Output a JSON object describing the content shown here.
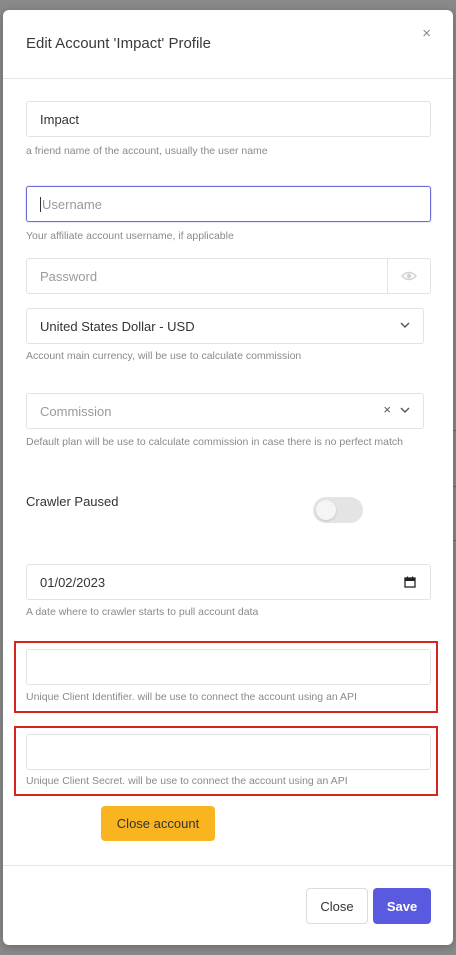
{
  "modal": {
    "title": "Edit Account 'Impact' Profile",
    "close_icon": "×"
  },
  "form": {
    "account_name": {
      "value": "Impact",
      "help": "a friend name of the account, usually the user name"
    },
    "username": {
      "placeholder": "Username",
      "help": "Your affiliate account username, if applicable"
    },
    "password": {
      "placeholder": "Password"
    },
    "currency": {
      "value": "United States Dollar - USD",
      "help": "Account main currency, will be use to calculate commission"
    },
    "plan": {
      "placeholder": "Commission",
      "clear": "×",
      "help": "Default plan will be use to calculate commission in case there is no perfect match"
    },
    "crawler": {
      "label": "Crawler Paused",
      "checked": false
    },
    "start_date": {
      "value": "01/02/2023",
      "help": "A date where to crawler starts to pull account data"
    },
    "client_id": {
      "value": "",
      "help": "Unique Client Identifier. will be use to connect the account using an API"
    },
    "client_secret": {
      "value": "",
      "help": "Unique Client Secret. will be use to connect the account using an API"
    }
  },
  "buttons": {
    "close_account": "Close account",
    "close": "Close",
    "save": "Save"
  },
  "colors": {
    "primary": "#5a5ae0",
    "warning": "#f9b520",
    "highlight": "#d9231f"
  }
}
